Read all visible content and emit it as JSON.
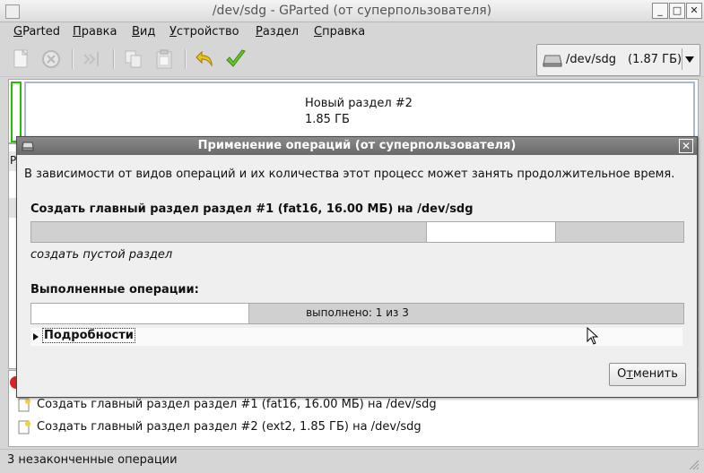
{
  "window": {
    "title": "/dev/sdg - GParted (от суперпользователя)",
    "controls": {
      "minimize": "_",
      "maximize": "□",
      "close": "✕"
    }
  },
  "menubar": {
    "items": [
      {
        "label": "GParted",
        "mnemonic": "G",
        "rest": "Parted"
      },
      {
        "label": "Правка",
        "mnemonic": "П",
        "rest": "равка"
      },
      {
        "label": "Вид",
        "mnemonic": "В",
        "rest": "ид"
      },
      {
        "label": "Устройство",
        "mnemonic": "У",
        "rest": "стройство"
      },
      {
        "label": "Раздел",
        "mnemonic": "Р",
        "rest": "аздел"
      },
      {
        "label": "Справка",
        "mnemonic": "С",
        "rest": "правка"
      }
    ]
  },
  "toolbar": {
    "device_name": "/dev/sdg",
    "device_size": "(1.87 ГБ)"
  },
  "graph": {
    "partition_name": "Новый раздел #2",
    "partition_size": "1.85 ГБ"
  },
  "list": {
    "header_fragment": "Р"
  },
  "pending_ops": [
    "Создать главный раздел раздел #1 (fat16, 16.00 МБ) на /dev/sdg",
    "Создать главный раздел раздел #2 (ext2, 1.85 ГБ) на /dev/sdg"
  ],
  "status": {
    "text": "3 незаконченные операции"
  },
  "dialog": {
    "title": "Применение операций (от суперпользователя)",
    "description": "В зависимости от видов операций и их количества этот процесс может занять продолжительное время.",
    "current_operation": "Создать главный раздел раздел #1 (fat16, 16.00 МБ) на /dev/sdg",
    "current_step": "создать пустой раздел",
    "completed_label": "Выполненные операции:",
    "completed_text": "выполнено: 1 из 3",
    "completed_fraction": 0.333,
    "details_label": "Подробности",
    "cancel_label": "Отменить",
    "cancel_mnemonic": "т"
  }
}
